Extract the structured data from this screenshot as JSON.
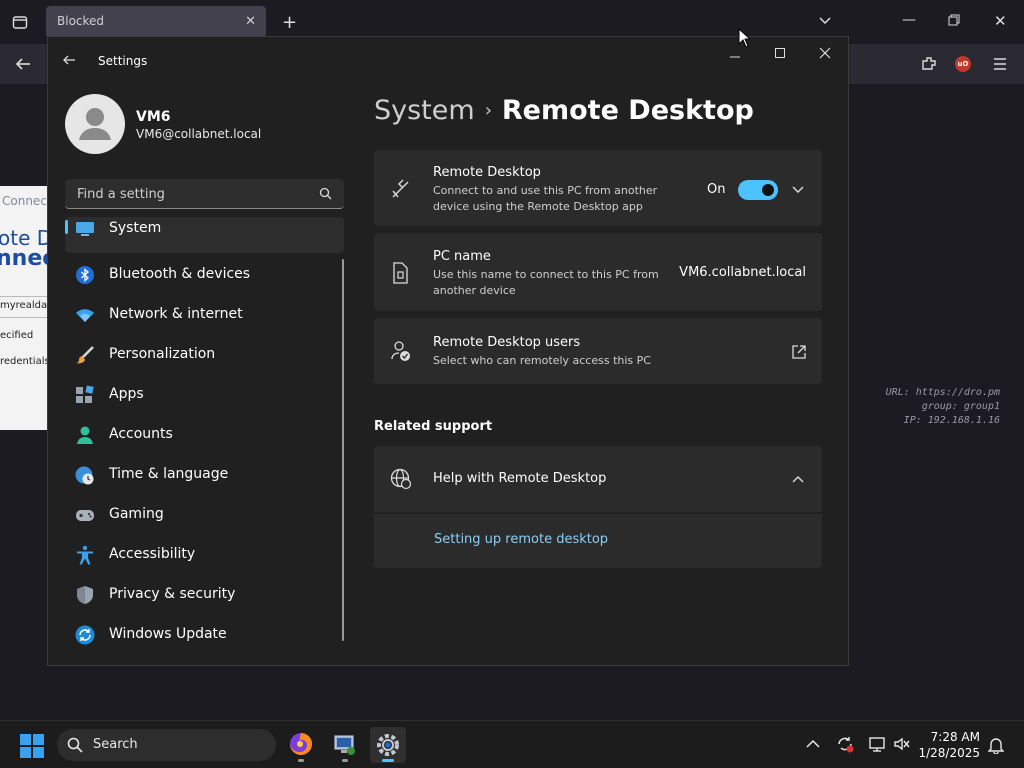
{
  "browser": {
    "tab_title": "Blocked",
    "bg_texts": [
      "Connect",
      "ote D",
      "nnect",
      "myrealdata",
      "ecified",
      "redentials"
    ]
  },
  "watermark": {
    "url": "URL: https://dro.pm",
    "group": "group: group1",
    "ip": "IP: 192.168.1.16"
  },
  "settings": {
    "window_title": "Settings",
    "user": {
      "name": "VM6",
      "email": "VM6@collabnet.local"
    },
    "search_placeholder": "Find a setting",
    "nav": [
      {
        "label": "System",
        "icon": "system-icon",
        "selected": true
      },
      {
        "label": "Bluetooth & devices",
        "icon": "bluetooth-icon"
      },
      {
        "label": "Network & internet",
        "icon": "wifi-icon"
      },
      {
        "label": "Personalization",
        "icon": "brush-icon"
      },
      {
        "label": "Apps",
        "icon": "apps-icon"
      },
      {
        "label": "Accounts",
        "icon": "person-icon"
      },
      {
        "label": "Time & language",
        "icon": "globe-clock-icon"
      },
      {
        "label": "Gaming",
        "icon": "gamepad-icon"
      },
      {
        "label": "Accessibility",
        "icon": "accessibility-icon"
      },
      {
        "label": "Privacy & security",
        "icon": "shield-icon"
      },
      {
        "label": "Windows Update",
        "icon": "update-icon"
      }
    ],
    "breadcrumb": {
      "root": "System",
      "separator": "›",
      "current": "Remote Desktop"
    },
    "remote_desktop": {
      "title": "Remote Desktop",
      "description": "Connect to and use this PC from another device using the Remote Desktop app",
      "toggle_label": "On",
      "toggle_on": true
    },
    "pc_name": {
      "title": "PC name",
      "description": "Use this name to connect to this PC from another device",
      "value": "VM6.collabnet.local"
    },
    "rd_users": {
      "title": "Remote Desktop users",
      "description": "Select who can remotely access this PC"
    },
    "related_support": {
      "heading": "Related support",
      "help_title": "Help with Remote Desktop",
      "link": "Setting up remote desktop"
    }
  },
  "taskbar": {
    "search_label": "Search",
    "time": "7:28 AM",
    "date": "1/28/2025"
  },
  "colors": {
    "accent": "#4cc2ff",
    "link": "#8ccff5",
    "card": "#2b2b2b",
    "window_bg": "#202020"
  }
}
